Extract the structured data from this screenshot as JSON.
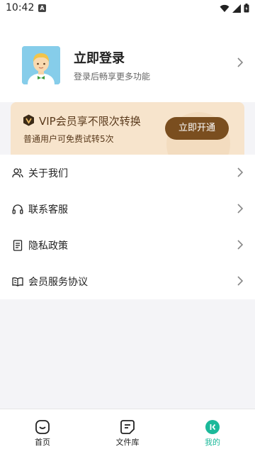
{
  "status_bar": {
    "time": "10:42",
    "notification_letter": "A"
  },
  "profile": {
    "title": "立即登录",
    "subtitle": "登录后畅享更多功能"
  },
  "vip": {
    "title": "VIP会员享不限次转换",
    "subtitle": "普通用户可免费试转5次",
    "button_label": "立即开通",
    "accent_color": "#7a4e1f",
    "background_color": "#f7e4cc"
  },
  "menu": {
    "items": [
      {
        "label": "关于我们",
        "icon": "user-group-icon"
      },
      {
        "label": "联系客服",
        "icon": "headset-icon"
      },
      {
        "label": "隐私政策",
        "icon": "document-icon"
      },
      {
        "label": "会员服务协议",
        "icon": "open-book-icon"
      }
    ]
  },
  "bottom_nav": {
    "items": [
      {
        "label": "首页",
        "icon": "home-icon",
        "active": false
      },
      {
        "label": "文件库",
        "icon": "file-library-icon",
        "active": false
      },
      {
        "label": "我的",
        "icon": "profile-icon",
        "active": true
      }
    ],
    "active_color": "#1bb99a"
  }
}
